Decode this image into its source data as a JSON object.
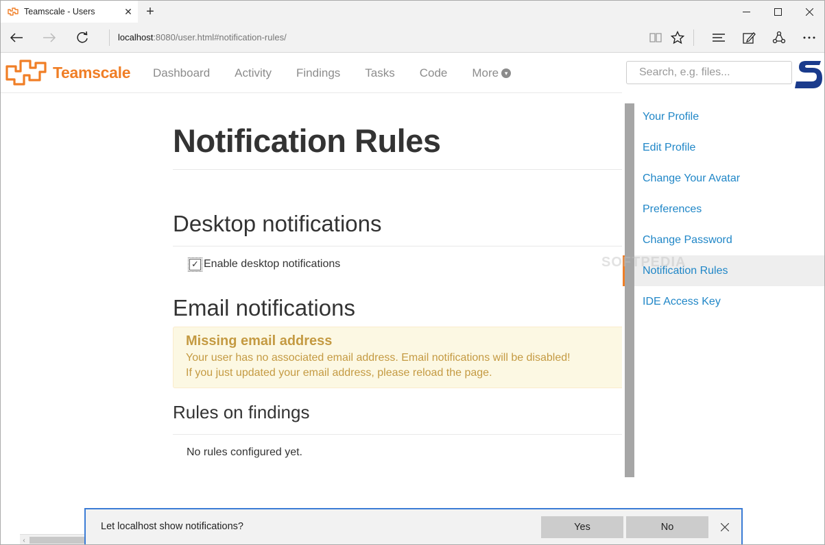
{
  "browser": {
    "tab_title": "Teamscale - Users",
    "url_host": "localhost",
    "url_rest": ":8080/user.html#notification-rules/"
  },
  "app": {
    "logo_text": "Teamscale",
    "nav": [
      "Dashboard",
      "Activity",
      "Findings",
      "Tasks",
      "Code",
      "More"
    ],
    "search_placeholder": "Search, e.g. files...",
    "brand_color": "#f07e26",
    "link_color": "#1f86c7"
  },
  "page": {
    "title": "Notification Rules",
    "desktop_section": "Desktop notifications",
    "desktop_checkbox_label": "Enable desktop notifications",
    "desktop_checkbox_checked": true,
    "email_section": "Email notifications",
    "alert": {
      "heading": "Missing email address",
      "line1": "Your user has no associated email address. Email notifications will be disabled!",
      "line2": "If you just updated your email address, please reload the page."
    },
    "rules_section": "Rules on findings",
    "no_rules_text": "No rules configured yet."
  },
  "sidebar": {
    "items": [
      {
        "label": "Your Profile",
        "active": false
      },
      {
        "label": "Edit Profile",
        "active": false
      },
      {
        "label": "Change Your Avatar",
        "active": false
      },
      {
        "label": "Preferences",
        "active": false
      },
      {
        "label": "Change Password",
        "active": false
      },
      {
        "label": "Notification Rules",
        "active": true
      },
      {
        "label": "IDE Access Key",
        "active": false
      }
    ]
  },
  "watermark": "SOFTPEDIA",
  "notification_bar": {
    "text": "Let localhost show notifications?",
    "yes_label": "Yes",
    "no_label": "No"
  }
}
